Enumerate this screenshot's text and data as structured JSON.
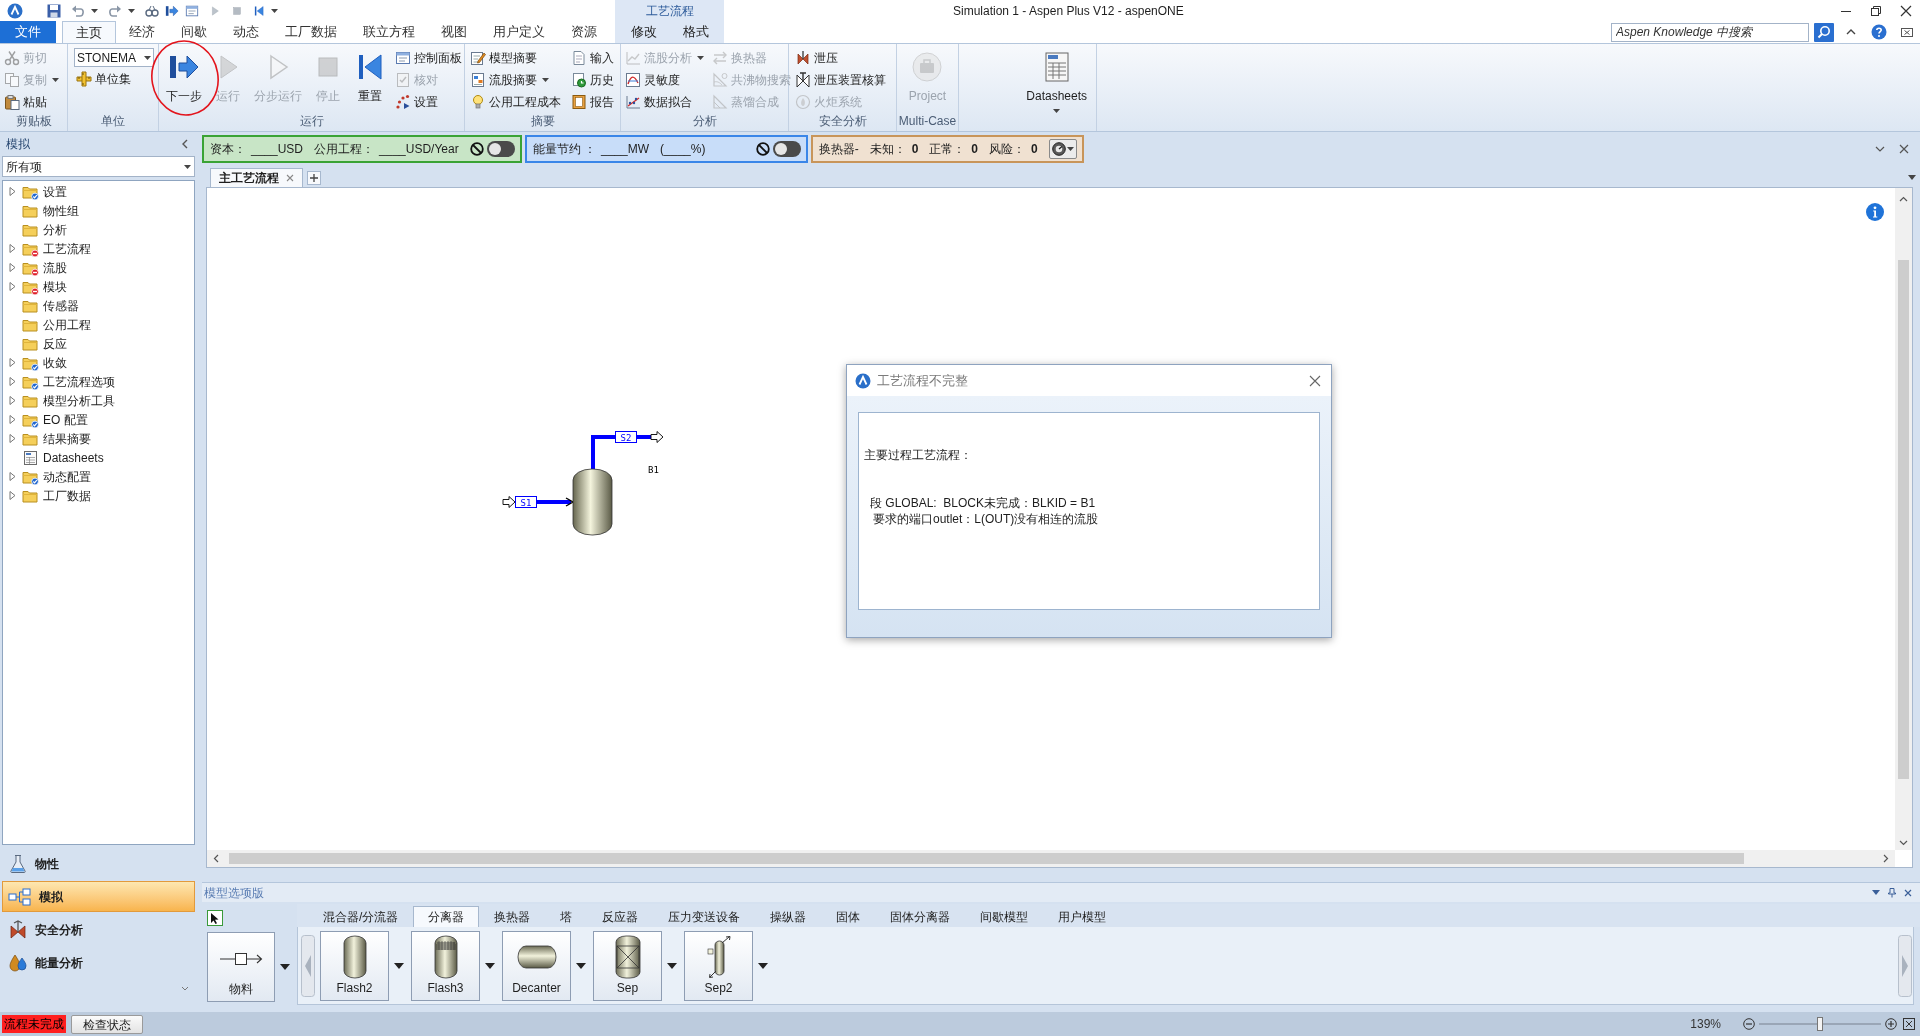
{
  "window": {
    "title": "Simulation 1 - Aspen Plus V12 - aspenONE",
    "context_group": "工艺流程"
  },
  "ribbon_tabs": [
    {
      "label": "文件",
      "kind": "file",
      "selected": false
    },
    {
      "label": "主页",
      "kind": "main",
      "selected": true
    },
    {
      "label": "经济",
      "kind": "main",
      "selected": false
    },
    {
      "label": "间歇",
      "kind": "main",
      "selected": false
    },
    {
      "label": "动态",
      "kind": "main",
      "selected": false
    },
    {
      "label": "工厂数据",
      "kind": "main",
      "selected": false
    },
    {
      "label": "联立方程",
      "kind": "main",
      "selected": false
    },
    {
      "label": "视图",
      "kind": "main",
      "selected": false
    },
    {
      "label": "用户定义",
      "kind": "main",
      "selected": false
    },
    {
      "label": "资源",
      "kind": "main",
      "selected": false
    },
    {
      "label": "修改",
      "kind": "context",
      "selected": false
    },
    {
      "label": "格式",
      "kind": "context",
      "selected": false
    }
  ],
  "search": {
    "placeholder": "Aspen Knowledge 中搜索"
  },
  "ribbon": [
    {
      "label": "剪贴板",
      "columns": [
        [
          {
            "kind": "small",
            "label": "剪切",
            "disabled": true,
            "dropdown": false
          },
          {
            "kind": "small",
            "label": "复制",
            "disabled": true,
            "dropdown": true
          },
          {
            "kind": "small",
            "label": "粘贴",
            "disabled": false,
            "dropdown": false
          }
        ]
      ]
    },
    {
      "label": "单位",
      "columns": [
        [
          {
            "kind": "combo",
            "value": "STONEMA",
            "disabled": false
          },
          {
            "kind": "small",
            "label": "单位集",
            "disabled": false,
            "dropdown": false
          }
        ]
      ]
    },
    {
      "label": "运行",
      "columns": [
        [
          {
            "kind": "large",
            "label": "下一步",
            "disabled": false,
            "dropdown": false,
            "circled": true
          }
        ],
        [
          {
            "kind": "large",
            "label": "运行",
            "disabled": true,
            "dropdown": false,
            "circled": false
          }
        ],
        [
          {
            "kind": "large",
            "label": "分步运行",
            "disabled": true,
            "dropdown": false,
            "circled": false
          }
        ],
        [
          {
            "kind": "large",
            "label": "停止",
            "disabled": true,
            "dropdown": false,
            "circled": false
          }
        ],
        [
          {
            "kind": "large",
            "label": "重置",
            "disabled": false,
            "dropdown": false,
            "circled": false
          }
        ],
        [
          {
            "kind": "small",
            "label": "控制面板",
            "disabled": false,
            "dropdown": false
          },
          {
            "kind": "small",
            "label": "核对",
            "disabled": true,
            "dropdown": false
          },
          {
            "kind": "small",
            "label": "设置",
            "disabled": false,
            "dropdown": false
          }
        ]
      ]
    },
    {
      "label": "摘要",
      "columns": [
        [
          {
            "kind": "small",
            "label": "模型摘要",
            "disabled": false,
            "dropdown": false
          },
          {
            "kind": "small",
            "label": "流股摘要",
            "disabled": false,
            "dropdown": true
          },
          {
            "kind": "small",
            "label": "公用工程成本",
            "disabled": false,
            "dropdown": false
          }
        ],
        [
          {
            "kind": "small",
            "label": "输入",
            "disabled": false,
            "dropdown": false
          },
          {
            "kind": "small",
            "label": "历史",
            "disabled": false,
            "dropdown": false
          },
          {
            "kind": "small",
            "label": "报告",
            "disabled": false,
            "dropdown": false
          }
        ]
      ]
    },
    {
      "label": "分析",
      "columns": [
        [
          {
            "kind": "small",
            "label": "流股分析",
            "disabled": true,
            "dropdown": true
          },
          {
            "kind": "small",
            "label": "灵敏度",
            "disabled": false,
            "dropdown": false
          },
          {
            "kind": "small",
            "label": "数据拟合",
            "disabled": false,
            "dropdown": false
          }
        ],
        [
          {
            "kind": "small",
            "label": "换热器",
            "disabled": true,
            "dropdown": false
          },
          {
            "kind": "small",
            "label": "共沸物搜索",
            "disabled": true,
            "dropdown": false
          },
          {
            "kind": "small",
            "label": "蒸馏合成",
            "disabled": true,
            "dropdown": false
          }
        ]
      ]
    },
    {
      "label": "安全分析",
      "columns": [
        [
          {
            "kind": "small",
            "label": "泄压",
            "disabled": false,
            "dropdown": false
          },
          {
            "kind": "small",
            "label": "泄压装置核算",
            "disabled": false,
            "dropdown": false
          },
          {
            "kind": "small",
            "label": "火炬系统",
            "disabled": true,
            "dropdown": false
          }
        ]
      ]
    },
    {
      "label": "Multi-Case",
      "columns": [
        [
          {
            "kind": "large",
            "label": "Project",
            "disabled": true,
            "dropdown": false,
            "circled": false
          }
        ]
      ]
    },
    {
      "columns": [
        [
          {
            "kind": "large",
            "label": "Datasheets",
            "disabled": false,
            "dropdown": true,
            "circled": false
          }
        ]
      ]
    }
  ],
  "status_panels": [
    {
      "kind": "toggle",
      "color": "#3aa335",
      "fields": [
        {
          "label": "资本：",
          "value": "____USD"
        },
        {
          "label": "公用工程：",
          "value": "____USD/Year"
        }
      ],
      "toggle": {
        "on": false
      }
    },
    {
      "kind": "toggle",
      "color": "#3a86e8",
      "fields": [
        {
          "label": "能量节约 ：",
          "value": "____MW"
        },
        {
          "value": "(____%)"
        }
      ],
      "toggle": {
        "on": false
      }
    },
    {
      "kind": "counts",
      "color": "#c8955a",
      "title": "换热器-",
      "fields": [
        {
          "label": "未知：",
          "value": "0"
        },
        {
          "label": "正常：",
          "value": "0"
        },
        {
          "label": "风险：",
          "value": "0"
        }
      ]
    }
  ],
  "sidebar": {
    "title": "模拟",
    "filter": "所有项",
    "tree": [
      {
        "label": "设置",
        "kind": "folder",
        "complete": true,
        "incomplete": false,
        "expandable": true
      },
      {
        "label": "物性组",
        "kind": "folder",
        "complete": false,
        "incomplete": false,
        "expandable": false
      },
      {
        "label": "分析",
        "kind": "folder",
        "complete": false,
        "incomplete": false,
        "expandable": false
      },
      {
        "label": "工艺流程",
        "kind": "folder",
        "complete": false,
        "incomplete": true,
        "expandable": true
      },
      {
        "label": "流股",
        "kind": "folder",
        "complete": false,
        "incomplete": true,
        "expandable": true
      },
      {
        "label": "模块",
        "kind": "folder",
        "complete": false,
        "incomplete": true,
        "expandable": true
      },
      {
        "label": "传感器",
        "kind": "folder",
        "complete": false,
        "incomplete": false,
        "expandable": false
      },
      {
        "label": "公用工程",
        "kind": "folder",
        "complete": false,
        "incomplete": false,
        "expandable": false
      },
      {
        "label": "反应",
        "kind": "folder",
        "complete": false,
        "incomplete": false,
        "expandable": false
      },
      {
        "label": "收敛",
        "kind": "folder",
        "complete": true,
        "incomplete": false,
        "expandable": true
      },
      {
        "label": "工艺流程选项",
        "kind": "folder",
        "complete": true,
        "incomplete": false,
        "expandable": true
      },
      {
        "label": "模型分析工具",
        "kind": "folder",
        "complete": false,
        "incomplete": false,
        "expandable": true
      },
      {
        "label": "EO 配置",
        "kind": "folder",
        "complete": true,
        "incomplete": false,
        "expandable": true
      },
      {
        "label": "结果摘要",
        "kind": "folder",
        "complete": false,
        "incomplete": false,
        "expandable": true
      },
      {
        "label": "Datasheets",
        "kind": "datasheet",
        "complete": false,
        "incomplete": false,
        "expandable": false
      },
      {
        "label": "动态配置",
        "kind": "folder",
        "complete": true,
        "incomplete": false,
        "expandable": true
      },
      {
        "label": "工厂数据",
        "kind": "folder",
        "complete": false,
        "incomplete": false,
        "expandable": true
      }
    ],
    "panes": [
      {
        "label": "物性",
        "selected": false
      },
      {
        "label": "模拟",
        "selected": true
      },
      {
        "label": "安全分析",
        "selected": false
      },
      {
        "label": "能量分析",
        "selected": false
      }
    ]
  },
  "document_tabs": [
    {
      "label": "主工艺流程",
      "selected": true
    }
  ],
  "flowsheet": {
    "blocks": [
      {
        "label": "B1"
      }
    ],
    "streams": [
      {
        "label": "S1",
        "kind": "feed"
      },
      {
        "label": "S2",
        "kind": "product"
      }
    ]
  },
  "dialog": {
    "title": "工艺流程不完整",
    "lines": [
      "主要过程工艺流程：",
      "段 GLOBAL:  BLOCK未完成：BLKID = B1",
      "要求的端口outlet：L(OUT)没有相连的流股"
    ]
  },
  "palette": {
    "title": "模型选项版",
    "tabs": [
      {
        "label": "混合器/分流器",
        "selected": false
      },
      {
        "label": "分离器",
        "selected": true
      },
      {
        "label": "换热器",
        "selected": false
      },
      {
        "label": "塔",
        "selected": false
      },
      {
        "label": "反应器",
        "selected": false
      },
      {
        "label": "压力变送设备",
        "selected": false
      },
      {
        "label": "操纵器",
        "selected": false
      },
      {
        "label": "固体",
        "selected": false
      },
      {
        "label": "固体分离器",
        "selected": false
      },
      {
        "label": "间歇模型",
        "selected": false
      },
      {
        "label": "用户模型",
        "selected": false
      }
    ],
    "items": [
      {
        "label": "物料",
        "kind": "stream"
      },
      {
        "label": "Flash2",
        "kind": "block"
      },
      {
        "label": "Flash3",
        "kind": "block"
      },
      {
        "label": "Decanter",
        "kind": "block"
      },
      {
        "label": "Sep",
        "kind": "block"
      },
      {
        "label": "Sep2",
        "kind": "block"
      }
    ]
  },
  "status_bar": {
    "status": "流程未完成",
    "button": "检查状态",
    "zoom": {
      "reading": "139%",
      "level": 0.5
    }
  }
}
